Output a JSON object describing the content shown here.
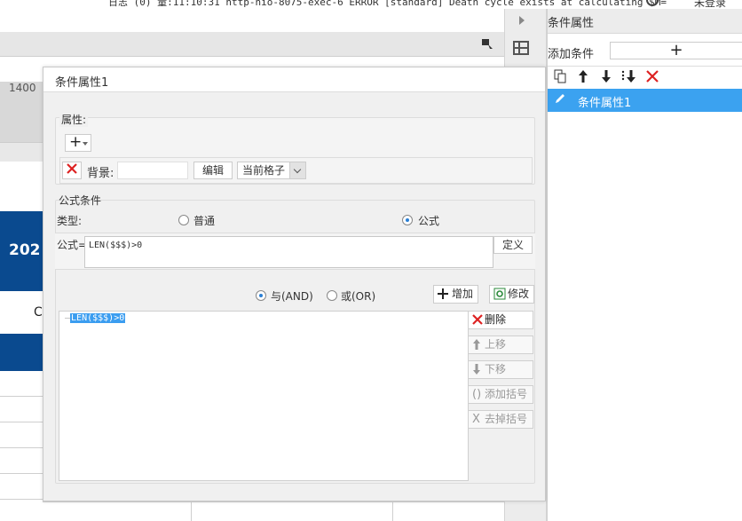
{
  "status_bar": {
    "text": "日志 (0) 量:11:10:31 http-nio-8075-exec-6 ERROR [standard] Death cycle exists at calculating $M=",
    "login": "未登录"
  },
  "background": {
    "ruler_number": "1400",
    "banner_text": "202",
    "row_char": "C"
  },
  "right_panel": {
    "title": "条件属性",
    "add_condition_label": "添加条件",
    "add_button": "+",
    "toolbar": [
      "copy-icon",
      "arrow-up-icon",
      "arrow-down-icon",
      "move-bottom-icon",
      "delete-icon"
    ],
    "items": [
      {
        "label": "条件属性1",
        "selected": true
      }
    ]
  },
  "dialog": {
    "title": "条件属性1",
    "properties": {
      "legend": "属性:",
      "add_button": "+",
      "background_row": {
        "label": "背景:",
        "edit_button": "编辑",
        "scope_value": "当前格子"
      }
    },
    "formula_section": {
      "legend": "公式条件",
      "type_label": "类型:",
      "type_options": [
        {
          "label": "普通",
          "checked": false
        },
        {
          "label": "公式",
          "checked": true
        }
      ],
      "formula_label": "公式=",
      "formula_value": "LEN($$$)>0",
      "define_button": "定义",
      "logic_options": [
        {
          "label": "与(AND)",
          "checked": true
        },
        {
          "label": "或(OR)",
          "checked": false
        }
      ],
      "add_button": "增加",
      "modify_button": "修改",
      "conditions": [
        "LEN($$$)>0"
      ],
      "side_buttons": [
        {
          "label": "删除",
          "enabled": true
        },
        {
          "label": "上移",
          "enabled": false
        },
        {
          "label": "下移",
          "enabled": false
        },
        {
          "label": "添加括号",
          "enabled": false
        },
        {
          "label": "去掉括号",
          "enabled": false
        }
      ]
    }
  },
  "colors": {
    "accent": "#3ba2f0",
    "banner_blue": "#0a4a8f",
    "delete_red": "#dd2222"
  }
}
